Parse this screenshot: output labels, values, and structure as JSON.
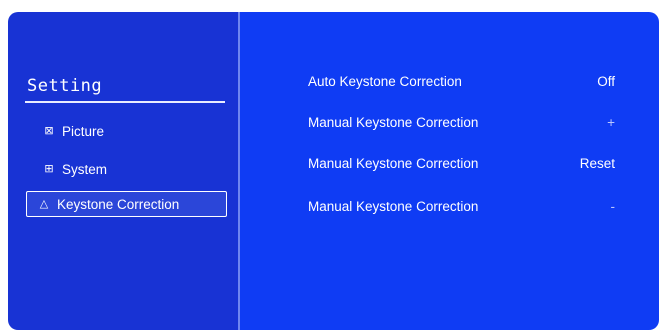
{
  "sidebar": {
    "title": "Setting",
    "items": [
      {
        "label": "Picture",
        "icon": "picture-icon",
        "glyph": "⊠"
      },
      {
        "label": "System",
        "icon": "grid-icon",
        "glyph": "⊞"
      },
      {
        "label": "Keystone Correction",
        "icon": "trapezoid-icon",
        "glyph": "△"
      }
    ],
    "selected_index": 2
  },
  "main": {
    "settings": [
      {
        "label": "Auto Keystone Correction",
        "value": "Off"
      },
      {
        "label": "Manual Keystone Correction",
        "value": "+"
      },
      {
        "label": "Manual Keystone Correction",
        "value": "Reset"
      },
      {
        "label": "Manual Keystone Correction",
        "value": "-"
      }
    ]
  },
  "colors": {
    "sidebar_bg": "#1833d4",
    "main_bg": "#0f3cf4",
    "text": "#ffffff"
  }
}
